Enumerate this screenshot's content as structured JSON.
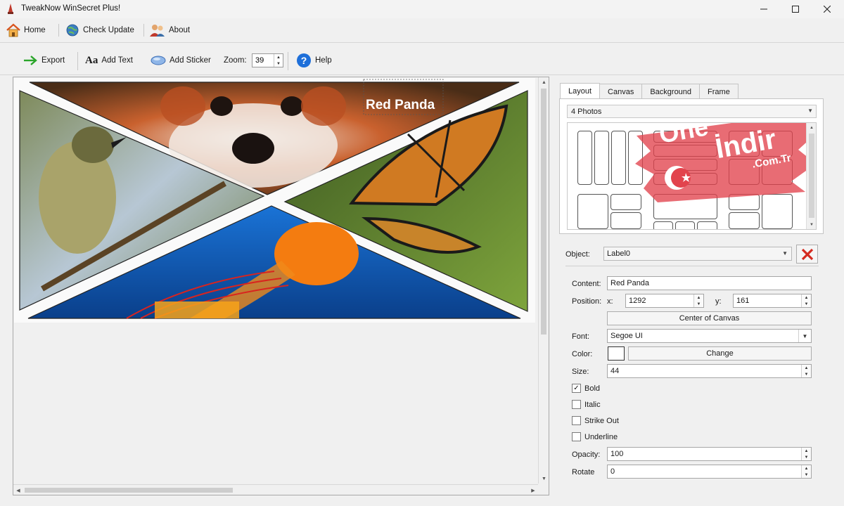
{
  "window": {
    "title": "TweakNow WinSecret Plus!"
  },
  "menu": {
    "home": "Home",
    "check_update": "Check Update",
    "about": "About"
  },
  "toolbar": {
    "export": "Export",
    "add_text": "Add Text",
    "add_sticker": "Add Sticker",
    "zoom_label": "Zoom:",
    "zoom_value": "39",
    "help": "Help"
  },
  "canvas": {
    "overlay_label": "Red Panda"
  },
  "tabs": [
    "Layout",
    "Canvas",
    "Background",
    "Frame"
  ],
  "active_tab": "Layout",
  "layout": {
    "selected": "4 Photos"
  },
  "watermark": {
    "line1": "One",
    "line2": "İndir",
    "line3": ".Com.Tr"
  },
  "object": {
    "label": "Object:",
    "value": "Label0"
  },
  "props": {
    "content_label": "Content:",
    "content_value": "Red Panda",
    "position_label": "Position:",
    "x_label": "x:",
    "x_value": "1292",
    "y_label": "y:",
    "y_value": "161",
    "center_button": "Center of Canvas",
    "font_label": "Font:",
    "font_value": "Segoe UI",
    "color_label": "Color:",
    "color_value": "#ffffff",
    "change_button": "Change",
    "size_label": "Size:",
    "size_value": "44",
    "bold_label": "Bold",
    "bold_checked": true,
    "italic_label": "Italic",
    "italic_checked": false,
    "strikeout_label": "Strike Out",
    "strikeout_checked": false,
    "underline_label": "Underline",
    "underline_checked": false,
    "opacity_label": "Opacity:",
    "opacity_value": "100",
    "rotate_label": "Rotate",
    "rotate_value": "0"
  }
}
